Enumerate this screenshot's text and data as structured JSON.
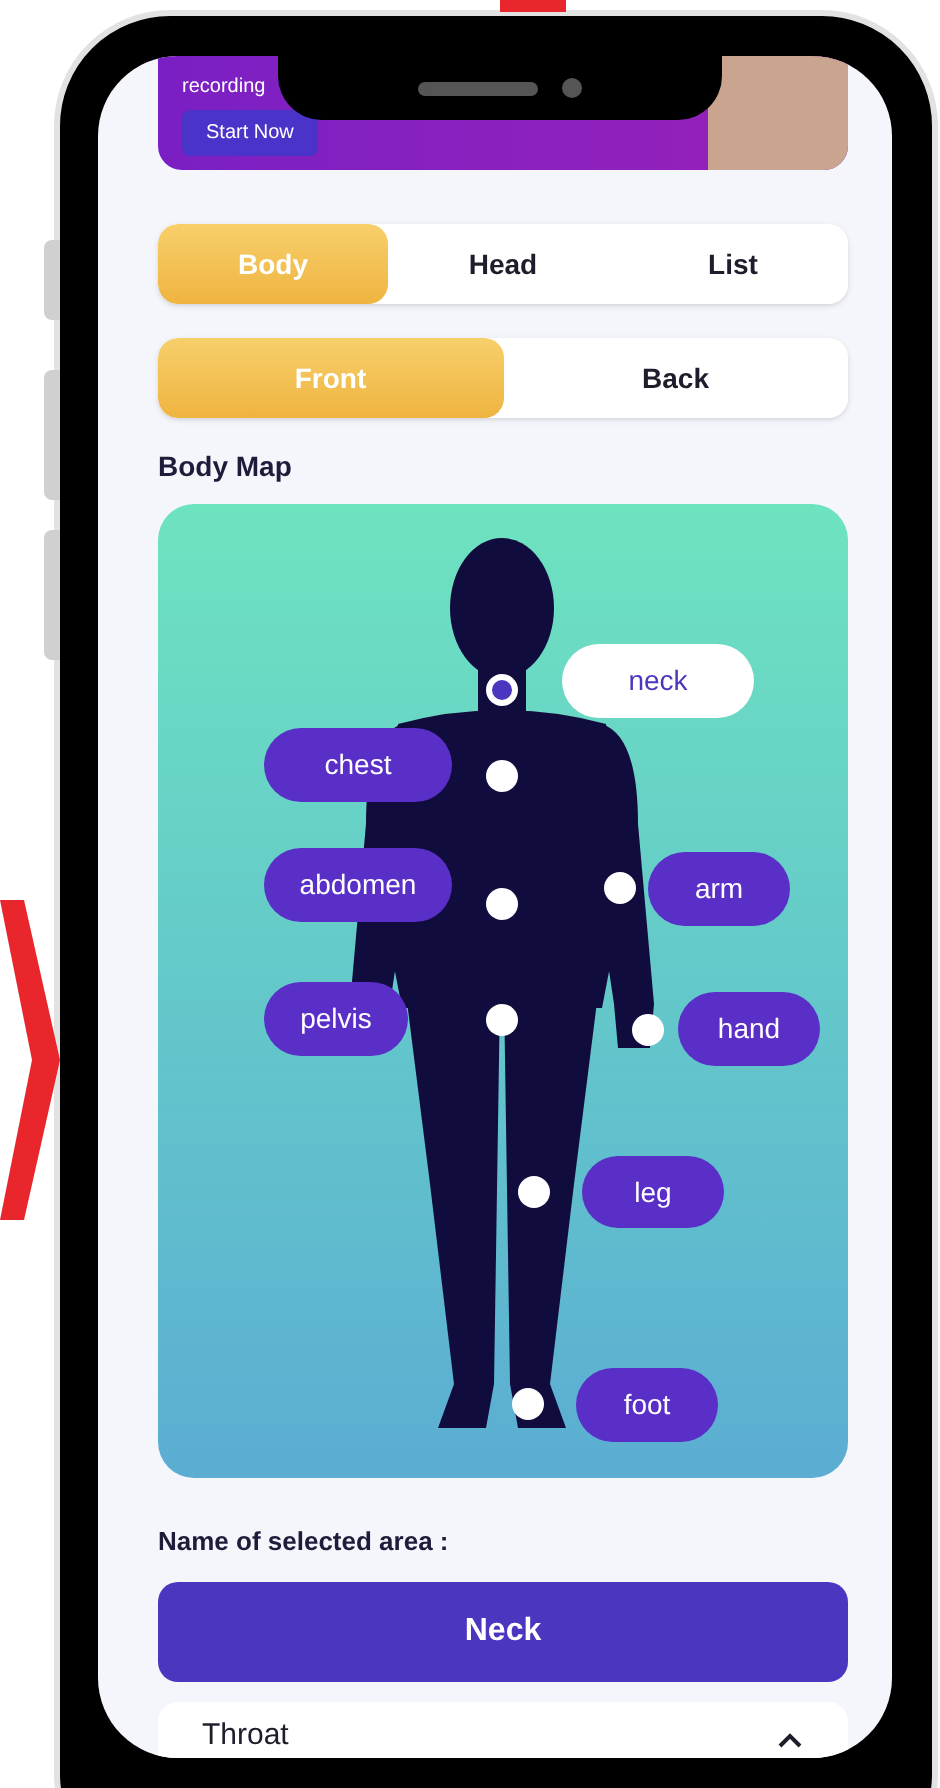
{
  "banner": {
    "text": "recording",
    "button": "Start Now"
  },
  "view_tabs": [
    {
      "label": "Body",
      "selected": true
    },
    {
      "label": "Head",
      "selected": false
    },
    {
      "label": "List",
      "selected": false
    }
  ],
  "side_tabs": [
    {
      "label": "Front",
      "selected": true
    },
    {
      "label": "Back",
      "selected": false
    }
  ],
  "map_title": "Body Map",
  "regions": [
    {
      "label": "neck",
      "selected": true
    },
    {
      "label": "chest",
      "selected": false
    },
    {
      "label": "abdomen",
      "selected": false
    },
    {
      "label": "pelvis",
      "selected": false
    },
    {
      "label": "arm",
      "selected": false
    },
    {
      "label": "hand",
      "selected": false
    },
    {
      "label": "leg",
      "selected": false
    },
    {
      "label": "foot",
      "selected": false
    }
  ],
  "selected_area": {
    "label": "Name of selected area :",
    "value": "Neck"
  },
  "accordion": [
    {
      "title": "Throat",
      "expanded": true
    }
  ]
}
